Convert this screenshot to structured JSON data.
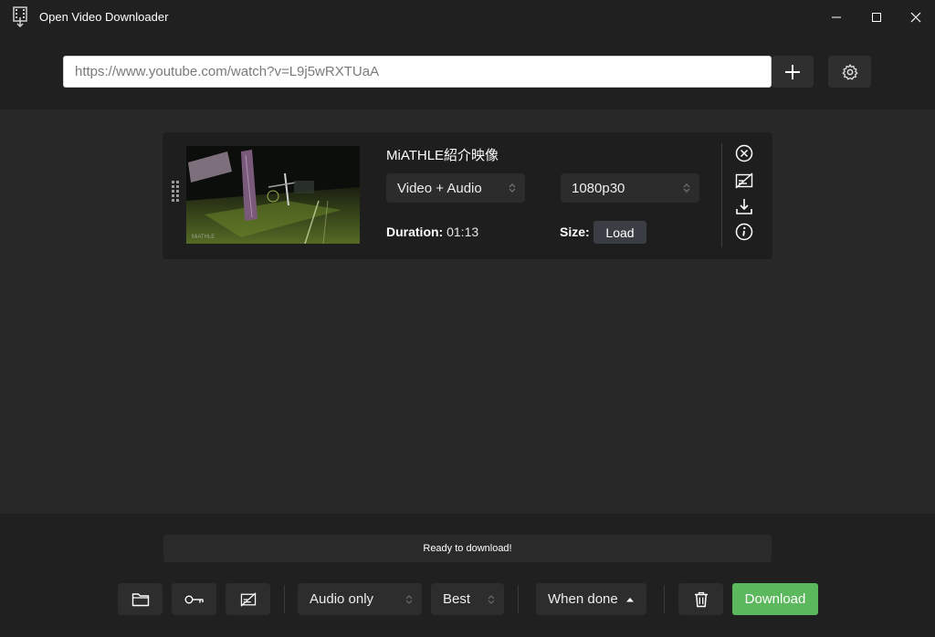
{
  "window": {
    "title": "Open Video Downloader"
  },
  "url_bar": {
    "value": "https://www.youtube.com/watch?v=L9j5wRXTUaA",
    "placeholder": ""
  },
  "video": {
    "title": "MiATHLE紹介映像",
    "thumbnail_watermark": "MiATHLE",
    "format": "Video + Audio",
    "quality": "1080p30",
    "duration_label": "Duration:",
    "duration": "01:13",
    "size_label": "Size:",
    "load_label": "Load"
  },
  "footer": {
    "status": "Ready to download!",
    "type_select": "Audio only",
    "quality_select": "Best",
    "when_done": "When done",
    "download_label": "Download"
  },
  "colors": {
    "accent_green": "#5cb85c",
    "background": "#282828",
    "bar_background": "#202020",
    "card_background": "#1e1e1e"
  },
  "icons": {
    "app": "film-download-icon",
    "add": "plus-icon",
    "settings": "gear-icon",
    "remove": "circle-x-icon",
    "subtitles": "subtitles-off-icon",
    "download": "download-icon",
    "info": "info-icon",
    "folder": "folder-icon",
    "auth": "key-icon",
    "subs_footer": "subtitles-off-icon",
    "clear": "trash-icon"
  }
}
